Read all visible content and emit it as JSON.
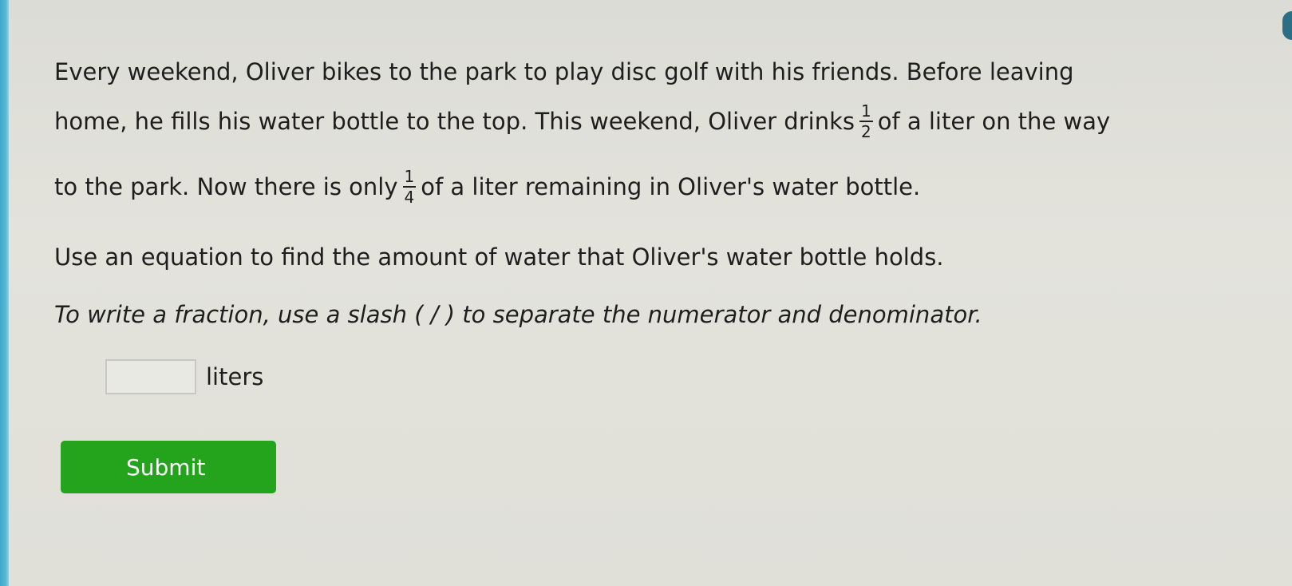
{
  "problem": {
    "line1": "Every weekend, Oliver bikes to the park to play disc golf with his friends. Before leaving",
    "line2_before": "home, he fills his water bottle to the top. This weekend, Oliver drinks",
    "frac1": {
      "numerator": "1",
      "denominator": "2"
    },
    "line2_after": "of a liter on the way",
    "line3_before": "to the park. Now there is only",
    "frac2": {
      "numerator": "1",
      "denominator": "4"
    },
    "line3_after": "of a liter remaining in Oliver's water bottle."
  },
  "instruction": "Use an equation to find the amount of water that Oliver's water bottle holds.",
  "hint": "To write a fraction, use a slash ( / ) to separate the numerator and denominator.",
  "answer": {
    "value": "",
    "unit": "liters"
  },
  "submit_label": "Submit",
  "colors": {
    "submit_bg": "#24a31d",
    "left_accent": "#3fa9c9",
    "background": "#e0e0d9"
  }
}
